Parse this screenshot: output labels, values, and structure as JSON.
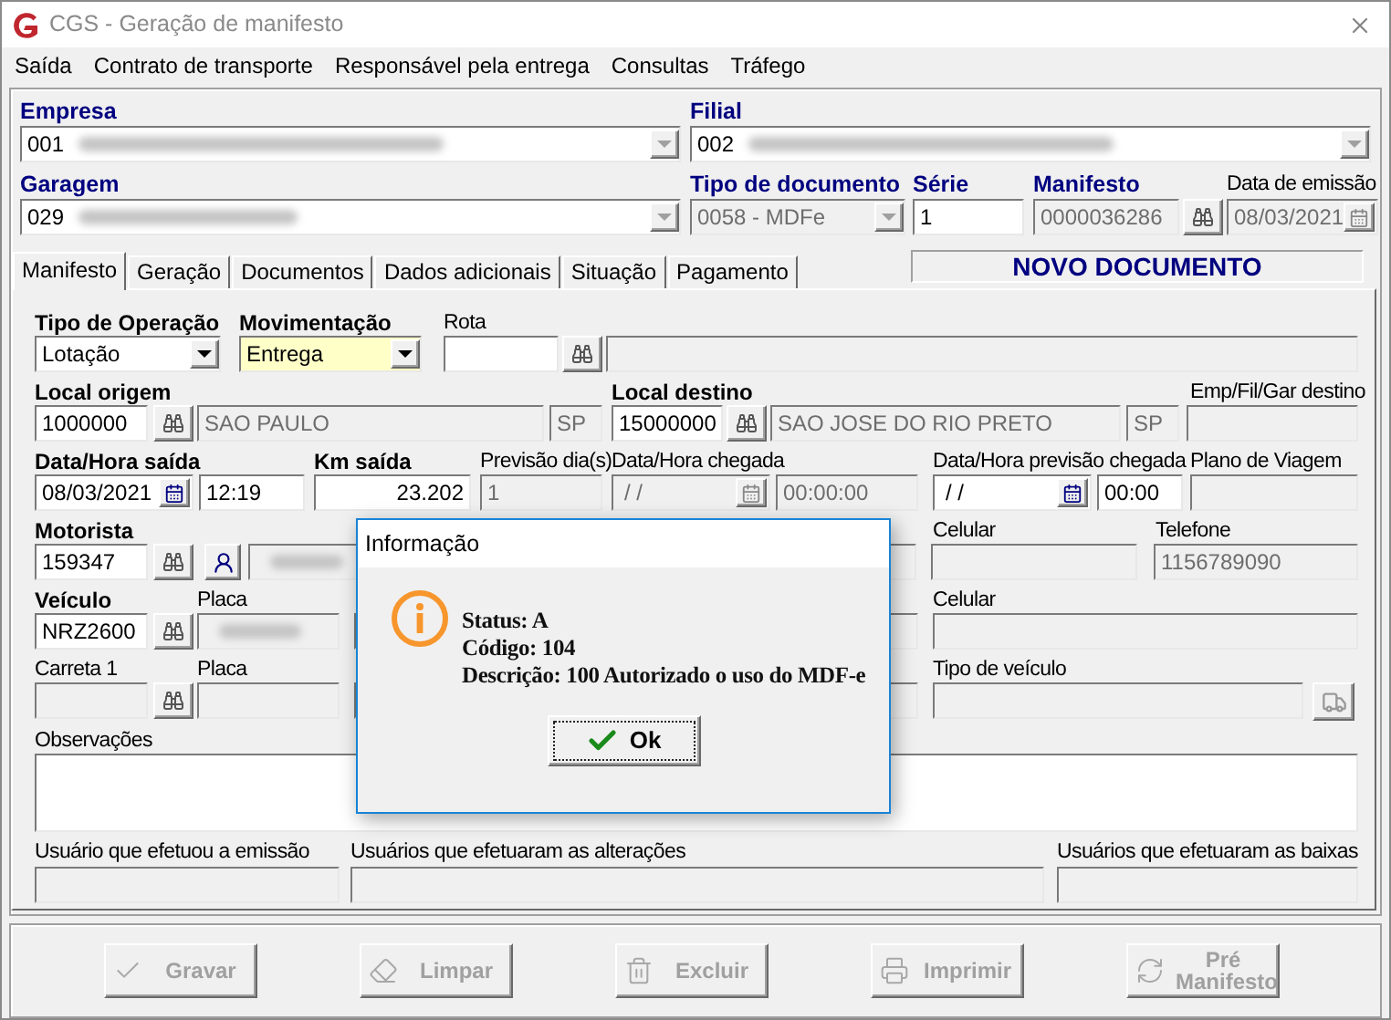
{
  "window": {
    "title": "CGS - Geração de manifesto"
  },
  "menu": [
    "Saída",
    "Contrato de transporte",
    "Responsável pela entrega",
    "Consultas",
    "Tráfego"
  ],
  "header": {
    "empresa": {
      "label": "Empresa",
      "code": "001"
    },
    "filial": {
      "label": "Filial",
      "code": "002"
    },
    "garagem": {
      "label": "Garagem",
      "code": "029"
    },
    "tipo_documento": {
      "label": "Tipo de documento",
      "value": "0058 - MDFe"
    },
    "serie": {
      "label": "Série",
      "value": "1"
    },
    "manifesto": {
      "label": "Manifesto",
      "value": "0000036286"
    },
    "data_emissao": {
      "label": "Data de emissão",
      "value": "08/03/2021"
    }
  },
  "tabs": [
    {
      "label": "Manifesto",
      "selected": true
    },
    {
      "label": "Geração",
      "selected": false
    },
    {
      "label": "Documentos",
      "selected": false
    },
    {
      "label": "Dados adicionais",
      "selected": false
    },
    {
      "label": "Situação",
      "selected": false
    },
    {
      "label": "Pagamento",
      "selected": false
    }
  ],
  "status_banner": "NOVO DOCUMENTO",
  "form": {
    "tipo_operacao": {
      "label": "Tipo de Operação",
      "value": "Lotação"
    },
    "movimentacao": {
      "label": "Movimentação",
      "value": "Entrega"
    },
    "rota": {
      "label": "Rota"
    },
    "local_origem": {
      "label": "Local origem",
      "code": "1000000",
      "city": "SAO PAULO",
      "uf": "SP"
    },
    "local_destino": {
      "label": "Local destino",
      "code": "15000000",
      "city": "SAO JOSE DO RIO PRETO",
      "uf": "SP"
    },
    "emp_fil_gar_destino": {
      "label": "Emp/Fil/Gar destino"
    },
    "data_hora_saida": {
      "label": "Data/Hora saída",
      "date": "08/03/2021",
      "time": "12:19"
    },
    "km_saida": {
      "label": "Km saída",
      "value": "23.202"
    },
    "previsao_dias": {
      "label": "Previsão dia(s)",
      "value": "1"
    },
    "data_hora_chegada": {
      "label": "Data/Hora chegada",
      "date": "/ /",
      "time": "00:00:00"
    },
    "data_hora_previsao_chegada": {
      "label": "Data/Hora previsão chegada",
      "date": "/ /",
      "time": "00:00"
    },
    "plano_viagem": {
      "label": "Plano de Viagem"
    },
    "motorista": {
      "label": "Motorista",
      "code": "159347"
    },
    "motorista_celular": {
      "label": "Celular"
    },
    "telefone": {
      "label": "Telefone",
      "value": "1156789090"
    },
    "veiculo": {
      "label": "Veículo",
      "code": "NRZ2600",
      "placa_label": "Placa"
    },
    "veiculo_celular": {
      "label": "Celular"
    },
    "carreta": {
      "label": "Carreta 1",
      "placa_label": "Placa"
    },
    "tipo_veiculo": {
      "label": "Tipo de veículo"
    },
    "observacoes": {
      "label": "Observações"
    },
    "usuarios": [
      {
        "label": "Usuário que efetuou a emissão"
      },
      {
        "label": "Usuários que efetuaram as alterações"
      },
      {
        "label": "Usuários que efetuaram as baixas"
      }
    ]
  },
  "buttons": [
    {
      "label": "Gravar",
      "kind": "check",
      "disabled": true
    },
    {
      "label": "Limpar",
      "kind": "eraser",
      "disabled": true
    },
    {
      "label": "Excluir",
      "kind": "trash",
      "disabled": true
    },
    {
      "label": "Imprimir",
      "kind": "printer",
      "disabled": true
    },
    {
      "label": "Pré Manifesto",
      "kind": "refresh",
      "disabled": true
    }
  ],
  "dialog": {
    "title": "Informação",
    "lines": [
      "Status: A",
      "Código: 104",
      "Descrição: 100 Autorizado o uso do MDF-e"
    ],
    "button": "Ok"
  }
}
